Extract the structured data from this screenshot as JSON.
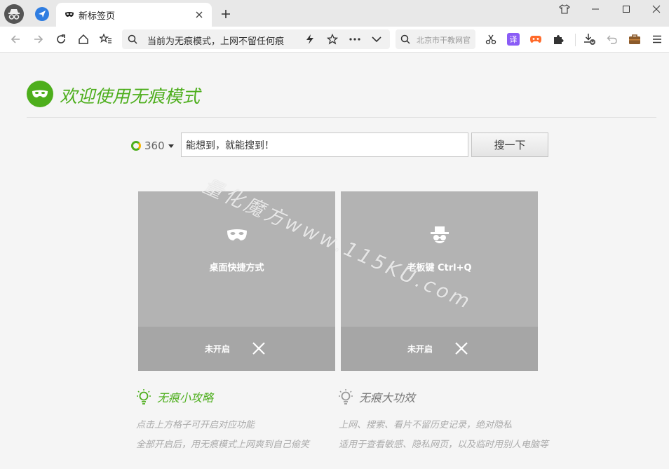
{
  "tabstrip": {
    "active_tab_title": "新标签页"
  },
  "toolbar": {
    "omnibox_text": "当前为无痕模式，上网不留任何痕",
    "search_placeholder": "北京市干教网官",
    "translate_ext_label": "译"
  },
  "page": {
    "heading": "欢迎使用无痕模式",
    "search": {
      "engine": "360",
      "input_value": "能想到，就能搜到！",
      "button_label": "搜一下"
    },
    "cards": [
      {
        "label": "桌面快捷方式",
        "status": "未开启"
      },
      {
        "label": "老板键 Ctrl+Q",
        "status": "未开启"
      }
    ],
    "tips_left": {
      "title": "无痕小攻略",
      "lines": [
        "点击上方格子可开启对应功能",
        "全部开启后，用无痕模式上网爽到自己偷笑"
      ]
    },
    "tips_right": {
      "title": "无痕大功效",
      "lines": [
        "上网、搜索、看片不留历史记录，绝对隐私",
        "适用于查看敏感、隐私网页，以及临时用别人电脑等"
      ]
    },
    "watermark": "量化魔方www.115KU.com"
  },
  "colors": {
    "accent": "#4dae1c",
    "card": "#b3b3b3",
    "card_footer": "#a6a6a6"
  }
}
